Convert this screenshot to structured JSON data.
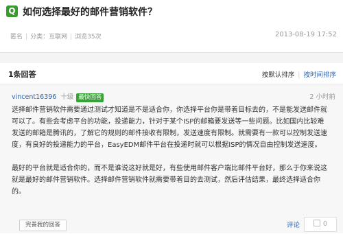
{
  "question": {
    "icon": "Q",
    "title": "如何选择最好的邮件营销软件？",
    "author": "匿名",
    "category_label": "分类：",
    "category": "互联网",
    "views": "浏览35次",
    "date": "2013-08-19 17:52"
  },
  "answers": {
    "count_label": "1条回答",
    "sort_by_vote": "按默认排序",
    "sort_by_time": "按时间排序"
  },
  "answer": {
    "username": "vincent16396",
    "level": "十级",
    "badge": "最快回答",
    "time": "2 小时前",
    "paragraph1": "选择邮件营销软件需要通过测试才知道是不是适合你，你选择平台你是带着目标去的，不是能发送邮件就可以了。有些会考虑平台的功能，投递能力，针对于某个ISP的邮箱要发送等一些问题。比如国内比较难发送的邮箱是腾讯的，了解它的规则的邮件接收有限制，发送速度有限制。就需要有一款可以控制发送速度，有良好的投递能力的平台，EasyEDM邮件平台在投递时就可以根据ISP的情况自由控制发送速度。",
    "paragraph2": "最好的平台就是适合你的，而不是谁说这好就是好，有些使用邮件客户端比邮件平台好，那么于你来说这就是最好的邮件营销软件。选择邮件营销软件就需要带着目的去测试，然后评估结果，最终选择适合你的。",
    "perfect_button": "完善我的回答",
    "comment_link": "评论",
    "like_count": "0"
  }
}
